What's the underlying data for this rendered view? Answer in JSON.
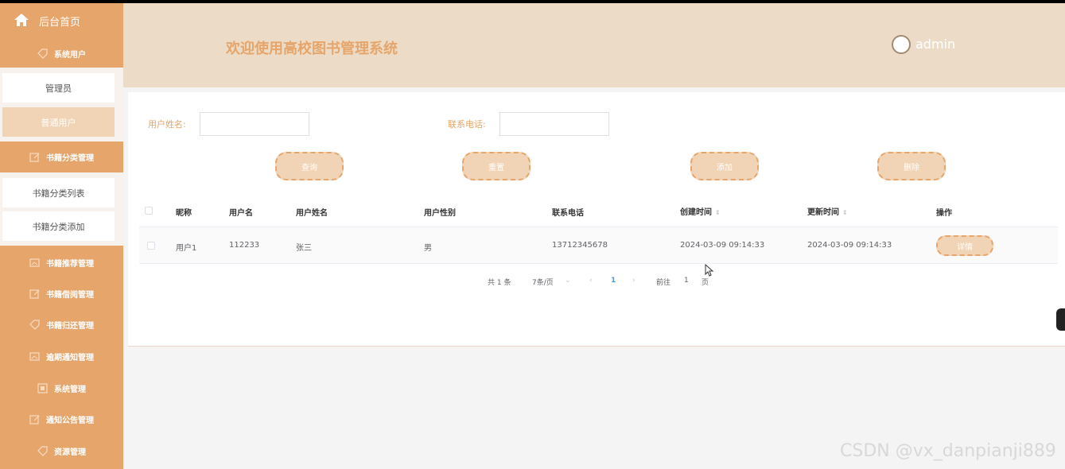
{
  "sidebar": {
    "home_label": "后台首页",
    "menu": [
      {
        "label": "系统用户",
        "icon": "tag-icon"
      },
      {
        "label": "书籍分类管理",
        "icon": "edit-icon"
      },
      {
        "label": "书籍推荐管理",
        "icon": "image-icon"
      },
      {
        "label": "书籍借阅管理",
        "icon": "edit-icon"
      },
      {
        "label": "书籍归还管理",
        "icon": "tag-icon"
      },
      {
        "label": "逾期通知管理",
        "icon": "image-icon"
      },
      {
        "label": "系统管理",
        "icon": "image-icon"
      },
      {
        "label": "通知公告管理",
        "icon": "edit-icon"
      },
      {
        "label": "资源管理",
        "icon": "tag-icon"
      }
    ],
    "sub_users": [
      "管理员",
      "普通用户"
    ],
    "sub_category": [
      "书籍分类列表",
      "书籍分类添加"
    ]
  },
  "header": {
    "title": "欢迎使用高校图书管理系统",
    "user": "admin"
  },
  "search": {
    "name_label": "用户姓名:",
    "phone_label": "联系电话:",
    "name_value": "",
    "phone_value": ""
  },
  "buttons": {
    "query": "查询",
    "reset": "重置",
    "add": "添加",
    "delete": "删除",
    "detail": "详情"
  },
  "table": {
    "columns": [
      "昵称",
      "用户名",
      "用户姓名",
      "用户性别",
      "联系电话",
      "创建时间",
      "更新时间",
      "操作"
    ],
    "rows": [
      {
        "nickname": "用户1",
        "username": "112233",
        "realname": "张三",
        "gender": "男",
        "phone": "13712345678",
        "created": "2024-03-09 09:14:33",
        "updated": "2024-03-09 09:14:33"
      }
    ]
  },
  "pagination": {
    "total": "共 1 条",
    "page_size": "7条/页",
    "current_page": "1",
    "goto_prefix": "前往",
    "goto_value": "1",
    "goto_suffix": "页"
  },
  "watermark": "CSDN @vx_danpianji889",
  "colors": {
    "accent": "#e6a56a",
    "accent_light": "#f1d3b6",
    "header_bg": "#ecdcc7"
  }
}
